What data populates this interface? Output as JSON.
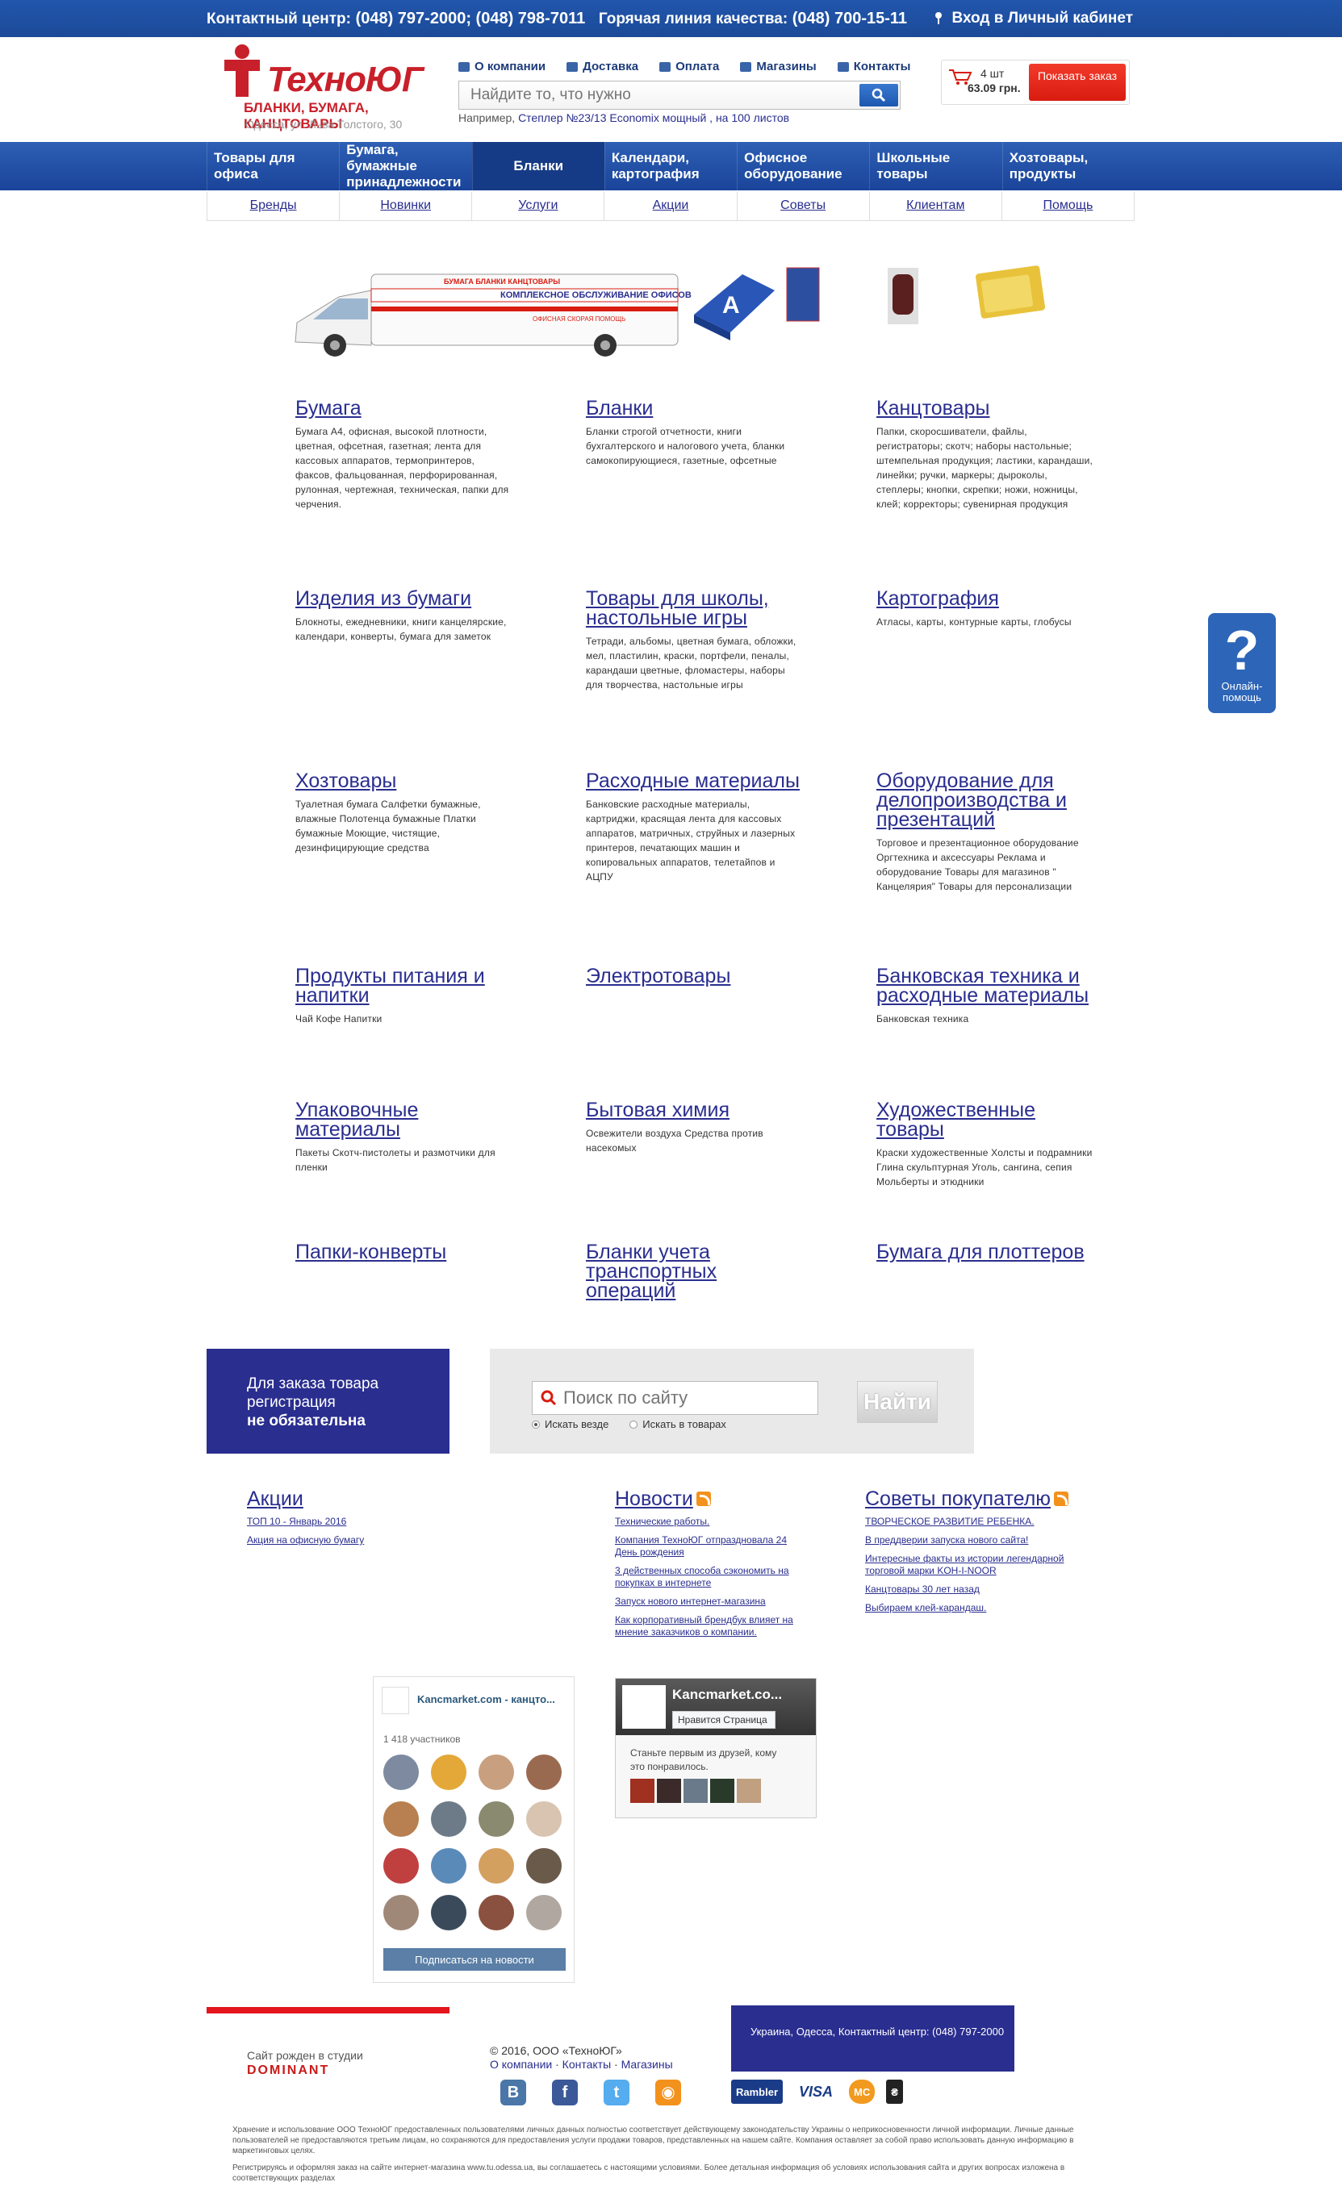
{
  "topbar": {
    "contact_label": "Контактный центр:",
    "contact_phones": "(048) 797-2000; (048) 798-7011",
    "hotline_label": "Горячая линия качества:",
    "hotline_phone": "(048) 700-15-11",
    "login": "Вход в Личный кабинет"
  },
  "logo": {
    "word": "ТехноЮГ",
    "tagline": "БЛАНКИ, БУМАГА, КАНЦТОВАРЫ",
    "address": "Одесса, ул. Льва Толстого, 30"
  },
  "nav1": [
    "О компании",
    "Доставка",
    "Оплата",
    "Магазины",
    "Контакты"
  ],
  "search": {
    "placeholder": "Найдите то, что нужно",
    "example_label": "Например,",
    "example_link": "Степлер №23/13 Economix мощный , на 100 листов"
  },
  "cart": {
    "count": "4 шт",
    "sum": "63.09 грн.",
    "button": "Показать заказ"
  },
  "mainnav": [
    "Товары для офиса",
    "Бумага, бумажные принадлежности",
    "Бланки",
    "Календари, картография",
    "Офисное оборудование",
    "Школьные товары",
    "Хозтовары, продукты"
  ],
  "subnav": [
    "Бренды",
    "Новинки",
    "Услуги",
    "Акции",
    "Советы",
    "Клиентам",
    "Помощь"
  ],
  "banner": {
    "van_stripe": "БУМАГА    БЛАНКИ    КАНЦТОВАРЫ",
    "van_slogan": "КОМПЛЕКСНОЕ ОБСЛУЖИВАНИЕ ОФИСОВ",
    "van_sub": "ОФИСНАЯ СКОРАЯ ПОМОЩЬ"
  },
  "categories": [
    {
      "title": "Бумага",
      "desc": "Бумага А4, офисная, высокой плотности, цветная, офсетная, газетная; лента для кассовых аппаратов, термопринтеров, факсов, фальцованная, перфорированная, рулонная, чертежная, техническая, папки для черчения."
    },
    {
      "title": "Бланки",
      "desc": "Бланки строгой отчетности, книги бухгалтерского и налогового учета, бланки самокопирующиеся, газетные, офсетные"
    },
    {
      "title": "Канцтовары",
      "desc": "Папки, скоросшиватели, файлы, регистраторы; скотч; наборы настольные; штемпельная продукция; ластики, карандаши, линейки; ручки, маркеры; дыроколы, степлеры; кнопки, скрепки; ножи, ножницы, клей; корректоры; сувенирная продукция"
    },
    {
      "title": "Изделия из бумаги",
      "desc": "Блокноты, ежедневники, книги канцелярские, календари, конверты, бумага для заметок"
    },
    {
      "title": "Товары для школы, настольные игры",
      "desc": "Тетради, альбомы, цветная бумага, обложки, мел, пластилин, краски, портфели, пеналы, карандаши цветные, фломастеры, наборы для творчества, настольные игры"
    },
    {
      "title": "Картография",
      "desc": "Атласы, карты, контурные карты, глобусы"
    },
    {
      "title": "Хозтовары",
      "desc": "Туалетная бумага Салфетки бумажные, влажные Полотенца бумажные Платки бумажные Моющие, чистящие, дезинфицирующие средства"
    },
    {
      "title": "Расходные материалы",
      "desc": "Банковские расходные материалы, картриджи, красящая лента для кассовых аппаратов, матричных, струйных и лазерных принтеров, печатающих машин и копировальных аппаратов, телетайпов и АЦПУ"
    },
    {
      "title": "Оборудование для делопроизводства и презентаций",
      "desc": "Торговое и презентационное оборудование Оргтехника и аксессуары Реклама и оборудование Товары для магазинов \" Канцелярия\" Товары для персонализации"
    },
    {
      "title": "Продукты питания и напитки",
      "desc": "Чай Кофе Напитки"
    },
    {
      "title": "Электротовары",
      "desc": ""
    },
    {
      "title": "Банковская техника и расходные материалы",
      "desc": "Банковская техника"
    },
    {
      "title": "Упаковочные материалы",
      "desc": "Пакеты Скотч-пистолеты и размотчики для пленки"
    },
    {
      "title": "Бытовая химия",
      "desc": "Освежители воздуха Средства против насекомых"
    },
    {
      "title": "Художественные товары",
      "desc": "Краски художественные Холсты и подрамники Глина скульптурная Уголь, сангина, сепия Мольберты и этюдники"
    },
    {
      "title": "Папки-конверты",
      "desc": ""
    },
    {
      "title": "Бланки учета транспортных операций",
      "desc": ""
    },
    {
      "title": "Бумага для плоттеров",
      "desc": ""
    }
  ],
  "help": {
    "label": "Онлайн-помощь"
  },
  "registration": {
    "line1": "Для заказа товара",
    "line2": "регистрация",
    "line3": "не обязательна"
  },
  "site_search": {
    "placeholder": "Поиск по сайту",
    "button": "Найти",
    "opt1": "Искать везде",
    "opt2": "Искать в товарах"
  },
  "news": {
    "promos": {
      "title": "Акции",
      "items": [
        "ТОП 10 - Январь 2016",
        "Акция на офисную бумагу"
      ]
    },
    "news": {
      "title": "Новости",
      "items": [
        "Технические работы.",
        "Компания ТехноЮГ отпраздновала 24 День рождения",
        "3 действенных способа сэкономить на покупках в интернете",
        "Запуск нового интернет-магазина",
        "Как корпоративный брендбук влияет на мнение заказчиков о компании."
      ]
    },
    "tips": {
      "title": "Советы покупателю",
      "items": [
        "ТВОРЧЕСКОЕ РАЗВИТИЕ РЕБЕНКА.",
        "В преддверии запуска нового сайта!",
        "Интересные факты из истории легендарной торговой марки KOH-I-NOOR",
        "Канцтовары 30 лет назад",
        "Выбираем клей-карандаш."
      ]
    }
  },
  "vk": {
    "name": "Kancmarket.com - канцто...",
    "members": "1 418 участников",
    "subscribe": "Подписаться на новости"
  },
  "fb": {
    "name": "Kancmarket.co...",
    "like": "Нравится Страница",
    "text": "Станьте первым из друзей, кому это понравилось."
  },
  "footer": {
    "studio_label": "Сайт рожден в студии",
    "studio_name": "DOMINANT",
    "copyright": "© 2016, ООО «ТехноЮГ»",
    "links": [
      "О компании",
      "Контакты",
      "Магазины"
    ],
    "address": "Украина, Одесса,",
    "contact_link": "Контактный центр: (048) 797-2000",
    "legal1": "Хранение и использование ООО ТехноЮГ предоставленных пользователями личных данных полностью соответствует действующему законодательству Украины о неприкосновенности личной информации. Личные данные пользователей не предоставляются третьим лицам, но сохраняются для предоставления услуги продажи товаров, представленных на нашем сайте. Компания оставляет за собой право использовать данную информацию в маркетинговых целях.",
    "legal2": "Регистрируясь и оформляя заказ на сайте интернет-магазина www.tu.odessa.ua, вы соглашаетесь с настоящими условиями. Более детальная информация об условиях использования сайта и других вопросах изложена в соответствующих разделах"
  },
  "colors": {
    "brand_blue": "#2a2e8f",
    "nav_blue": "#1f4fa3",
    "accent_red": "#e4161c"
  }
}
